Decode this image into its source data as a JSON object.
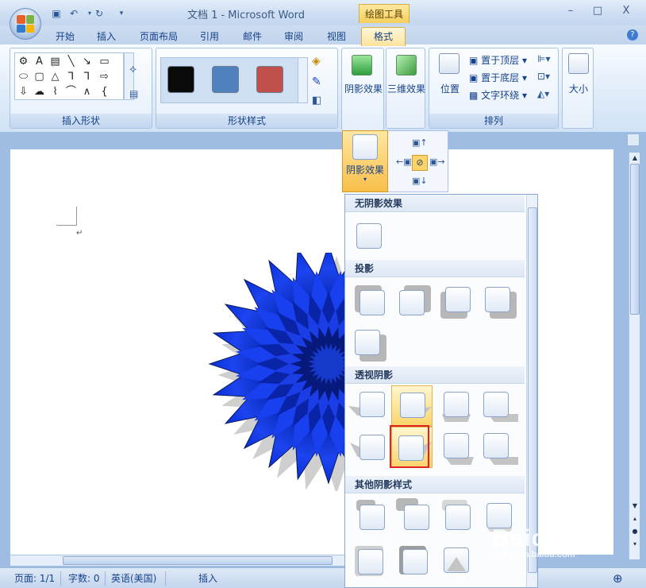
{
  "window": {
    "title": "文档 1 - Microsoft Word",
    "tool_tab_title": "绘图工具",
    "buttons": {
      "minimize": "–",
      "restore": "□",
      "close": "X"
    }
  },
  "quick_access": {
    "save_icon": "floppy-icon",
    "undo": "↶",
    "redo": "↻",
    "more": "▾"
  },
  "tabs": [
    "开始",
    "插入",
    "页面布局",
    "引用",
    "邮件",
    "审阅",
    "视图",
    "格式"
  ],
  "active_tab": "格式",
  "help": "?",
  "ribbon": {
    "insert_shapes": {
      "label": "插入形状",
      "icons": [
        "⚙",
        "A",
        "▤",
        "╲",
        "↘",
        "▭",
        "⬭",
        "▢",
        "△",
        "⅂",
        "⅂",
        "⇨",
        "⇩",
        "☁",
        "⌇",
        "⌒",
        "∧",
        "{"
      ]
    },
    "shape_styles": {
      "label": "形状样式",
      "swatches": [
        "#0a0a0a",
        "#4f81bd",
        "#c0504d"
      ]
    },
    "shadow_effects": {
      "label": "阴影效果"
    },
    "three_d": {
      "label": "三维效果"
    },
    "arrange": {
      "label": "排列",
      "position": "位置",
      "bring_to_front": "置于顶层",
      "send_to_back": "置于底层",
      "text_wrap": "文字环绕"
    },
    "size": {
      "label": "大小"
    }
  },
  "shadow_dropdown": {
    "button_label": "阴影效果"
  },
  "gallery": {
    "sections": [
      "无阴影效果",
      "投影",
      "透视阴影",
      "其他阴影样式"
    ]
  },
  "status": {
    "page": "页面: 1/1",
    "words": "字数: 0",
    "language": "英语(美国)",
    "mode": "插入"
  },
  "watermark": {
    "brand": "Baidu经验",
    "url": "jingyan.baidu.com"
  },
  "colors": {
    "accent": "#f8be4a",
    "selection": "#e02222",
    "star": "#0b2fd6"
  }
}
